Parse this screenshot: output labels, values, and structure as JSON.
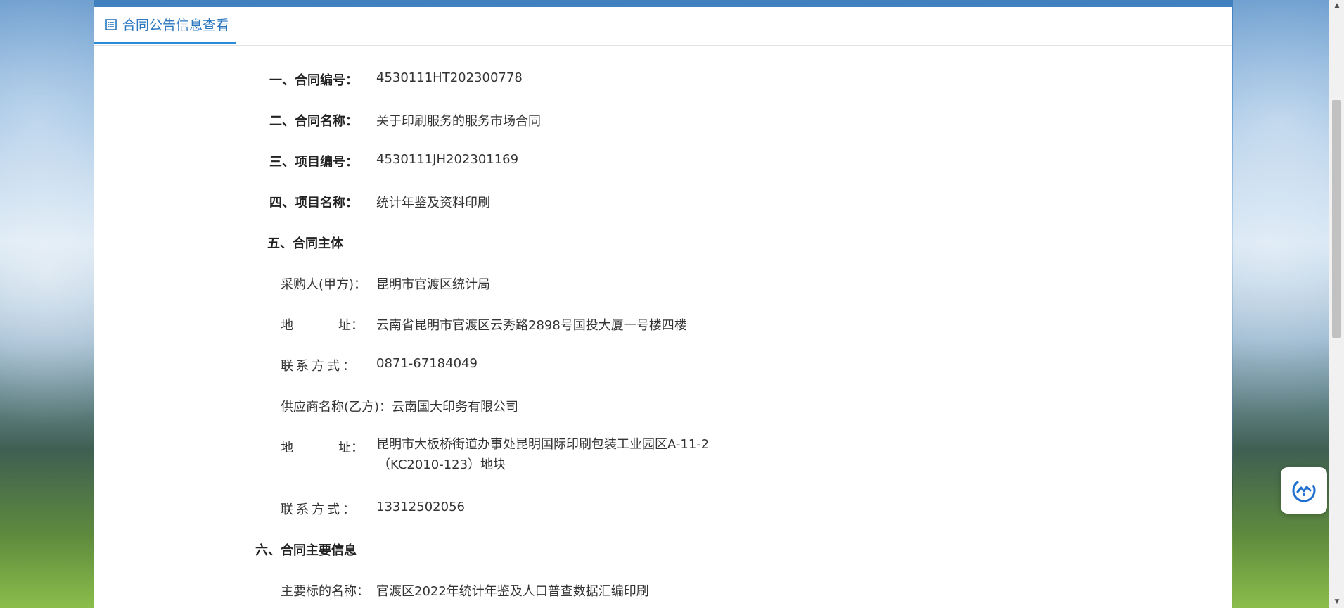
{
  "panel": {
    "tab_title": "合同公告信息查看"
  },
  "fields": {
    "contract_no_label": "一、合同编号：",
    "contract_no": "4530111HT202300778",
    "contract_name_label": "二、合同名称：",
    "contract_name": "关于印刷服务的服务市场合同",
    "project_no_label": "三、项目编号：",
    "project_no": "4530111JH202301169",
    "project_name_label": "四、项目名称：",
    "project_name": "统计年鉴及资料印刷",
    "section5_title": "五、合同主体",
    "buyer_label": "采购人(甲方)：",
    "buyer": "昆明市官渡区统计局",
    "addr_label_left": "地",
    "addr_label_right": "址：",
    "buyer_address": "云南省昆明市官渡区云秀路2898号国投大厦一号楼四楼",
    "contact_label": "联系方式：",
    "buyer_phone": "0871-67184049",
    "supplier_label": "供应商名称(乙方)：",
    "supplier": "云南国大印务有限公司",
    "supplier_address_line1": "昆明市大板桥街道办事处昆明国际印刷包装工业园区A-11-2",
    "supplier_address_line2": "（KC2010-123）地块",
    "supplier_phone": "13312502056",
    "section6_title": "六、合同主要信息",
    "main_subject_label": "主要标的名称：",
    "main_subject": "官渡区2022年统计年鉴及人口普查数据汇编印刷"
  },
  "icons": {
    "tab_icon": "list-icon",
    "float_icon": "ai-assistant-icon"
  },
  "colors": {
    "accent": "#2a8cd8",
    "tab_text": "#2a77c0"
  }
}
